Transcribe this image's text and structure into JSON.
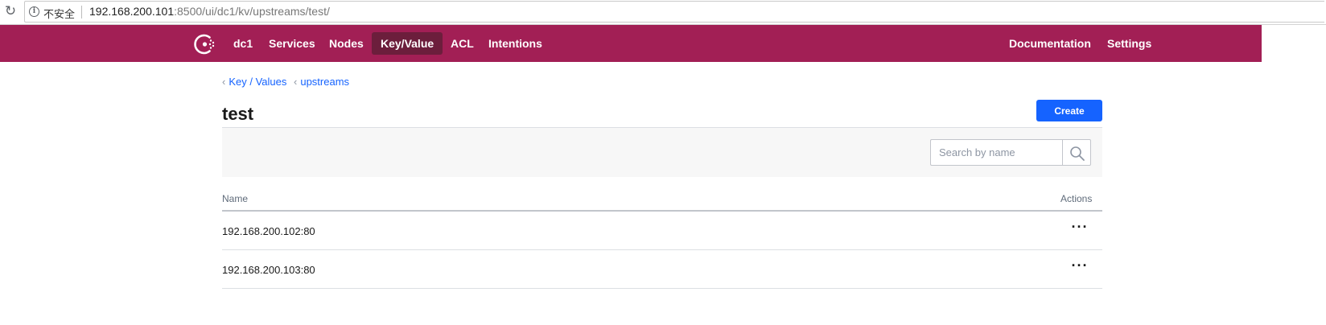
{
  "browser": {
    "insecure_label": "不安全",
    "url_host": "192.168.200.101",
    "url_rest": ":8500/ui/dc1/kv/upstreams/test/"
  },
  "nav": {
    "datacenter": "dc1",
    "items": [
      {
        "label": "Services",
        "active": false
      },
      {
        "label": "Nodes",
        "active": false
      },
      {
        "label": "Key/Value",
        "active": true
      },
      {
        "label": "ACL",
        "active": false
      },
      {
        "label": "Intentions",
        "active": false
      }
    ],
    "right": [
      "Documentation",
      "Settings"
    ],
    "brand_color": "#a21f55"
  },
  "breadcrumb": [
    "Key / Values",
    "upstreams"
  ],
  "page": {
    "title": "test",
    "create_label": "Create"
  },
  "search": {
    "placeholder": "Search by name",
    "value": ""
  },
  "table": {
    "columns": [
      "Name",
      "Actions"
    ],
    "rows": [
      {
        "name": "192.168.200.102:80",
        "actions": "···"
      },
      {
        "name": "192.168.200.103:80",
        "actions": "···"
      }
    ]
  },
  "colors": {
    "accent": "#1563ff"
  }
}
